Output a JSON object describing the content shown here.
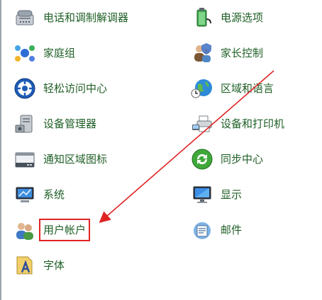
{
  "control_panel": {
    "items": [
      {
        "label": "电话和调制解调器",
        "icon": "phone-modem-icon"
      },
      {
        "label": "电源选项",
        "icon": "power-options-icon"
      },
      {
        "label": "家庭组",
        "icon": "homegroup-icon"
      },
      {
        "label": "家长控制",
        "icon": "parental-controls-icon"
      },
      {
        "label": "轻松访问中心",
        "icon": "ease-of-access-icon"
      },
      {
        "label": "区域和语言",
        "icon": "region-language-icon"
      },
      {
        "label": "设备管理器",
        "icon": "device-manager-icon"
      },
      {
        "label": "设备和打印机",
        "icon": "devices-printers-icon"
      },
      {
        "label": "通知区域图标",
        "icon": "notification-area-icon"
      },
      {
        "label": "同步中心",
        "icon": "sync-center-icon"
      },
      {
        "label": "系统",
        "icon": "system-icon"
      },
      {
        "label": "显示",
        "icon": "display-icon"
      },
      {
        "label": "用户帐户",
        "icon": "user-accounts-icon"
      },
      {
        "label": "邮件",
        "icon": "mail-icon"
      },
      {
        "label": "字体",
        "icon": "fonts-icon"
      }
    ]
  },
  "annotation": {
    "highlight_color": "#e02424",
    "highlighted_item": "用户帐户"
  },
  "colors": {
    "link_text": "#1f5f26"
  }
}
